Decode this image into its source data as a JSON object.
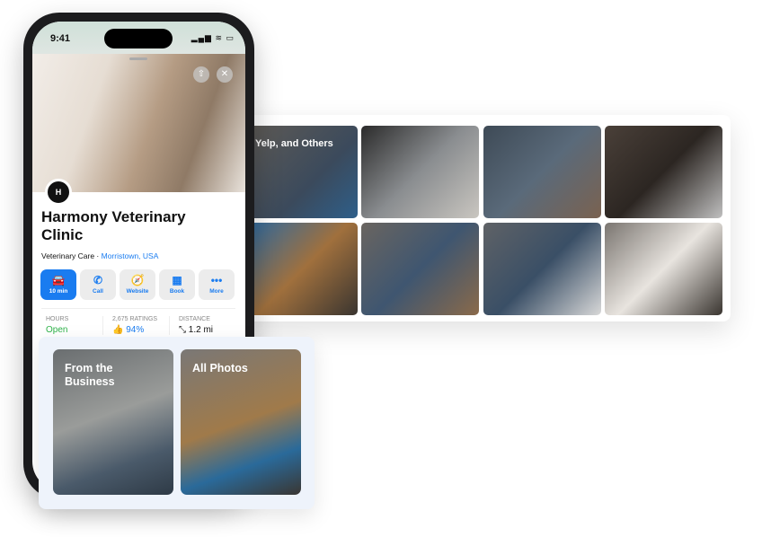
{
  "status_bar": {
    "time": "9:41",
    "icons": "▂▄▆ ≋ ▭"
  },
  "place": {
    "logo": "H",
    "name": "Harmony Veterinary Clinic",
    "category": "Veterinary Care",
    "separator": " · ",
    "location": "Morristown, USA"
  },
  "actions": [
    {
      "icon": "car-icon",
      "glyph": "🚘",
      "label": "10 min"
    },
    {
      "icon": "phone-icon",
      "glyph": "✆",
      "label": "Call"
    },
    {
      "icon": "compass-icon",
      "glyph": "🧭",
      "label": "Website"
    },
    {
      "icon": "calendar-icon",
      "glyph": "▦",
      "label": "Book"
    },
    {
      "icon": "more-icon",
      "glyph": "•••",
      "label": "More"
    }
  ],
  "stats": [
    {
      "label": "HOURS",
      "value": "Open",
      "color": "#2fb34a"
    },
    {
      "label": "2,675 RATINGS",
      "value": "👍 94%",
      "color": "#1a7cf0"
    },
    {
      "label": "DISTANCE",
      "value": "⤡ 1.2 mi",
      "color": "#111"
    }
  ],
  "gallery": {
    "caption": "Yelp, and Others"
  },
  "tiles": [
    {
      "label": "From the Business"
    },
    {
      "label": "All Photos"
    }
  ],
  "colors": {
    "accent": "#1a7cf0",
    "open": "#2fb34a"
  }
}
